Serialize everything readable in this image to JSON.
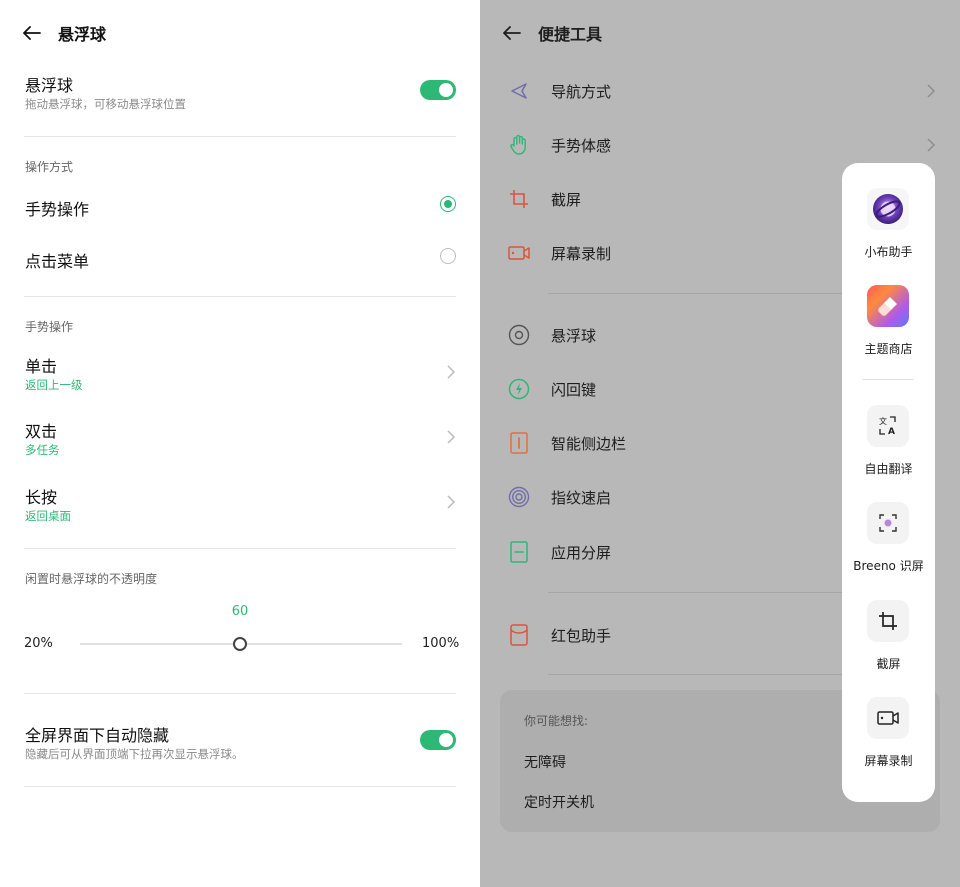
{
  "left": {
    "header": {
      "title": "悬浮球"
    },
    "float_ball": {
      "title": "悬浮球",
      "subtitle": "拖动悬浮球，可移动悬浮球位置",
      "enabled": true
    },
    "mode_section": {
      "label": "操作方式",
      "options": [
        {
          "label": "手势操作",
          "selected": true
        },
        {
          "label": "点击菜单",
          "selected": false
        }
      ]
    },
    "gesture_section": {
      "label": "手势操作",
      "items": [
        {
          "title": "单击",
          "value": "返回上一级"
        },
        {
          "title": "双击",
          "value": "多任务"
        },
        {
          "title": "长按",
          "value": "返回桌面"
        }
      ]
    },
    "opacity": {
      "label": "闲置时悬浮球的不透明度",
      "value": "60",
      "min": "20%",
      "max": "100%"
    },
    "fullscreen_hide": {
      "title": "全屏界面下自动隐藏",
      "subtitle": "隐藏后可从界面顶端下拉再次显示悬浮球。",
      "enabled": true
    }
  },
  "right": {
    "header": {
      "title": "便捷工具"
    },
    "items": [
      {
        "label": "导航方式",
        "icon": "navigation-arrow-icon",
        "color": "#6f6fa8"
      },
      {
        "label": "手势体感",
        "icon": "hand-icon",
        "color": "#2db876"
      },
      {
        "label": "截屏",
        "icon": "crop-icon",
        "color": "#d9563a"
      },
      {
        "label": "屏幕录制",
        "icon": "video-record-icon",
        "color": "#d9563a"
      },
      {
        "label": "悬浮球",
        "icon": "float-ball-icon",
        "color": "#555555"
      },
      {
        "label": "闪回键",
        "icon": "flash-back-icon",
        "color": "#2db876"
      },
      {
        "label": "智能侧边栏",
        "icon": "sidebar-icon",
        "color": "#e2703a"
      },
      {
        "label": "指纹速启",
        "icon": "fingerprint-icon",
        "color": "#6f6fa8"
      },
      {
        "label": "应用分屏",
        "icon": "split-screen-icon",
        "color": "#2db876"
      },
      {
        "label": "红包助手",
        "icon": "red-packet-icon",
        "color": "#d9563a"
      }
    ],
    "suggest": {
      "label": "你可能想找:",
      "items": [
        "无障碍",
        "定时开关机"
      ]
    },
    "toolbox": {
      "tools": [
        {
          "label": "小布助手",
          "icon": "breeno-assistant-icon"
        },
        {
          "label": "主题商店",
          "icon": "theme-store-icon"
        },
        {
          "label": "自由翻译",
          "icon": "translate-icon"
        },
        {
          "label": "Breeno 识屏",
          "icon": "screen-recognition-icon"
        },
        {
          "label": "截屏",
          "icon": "crop-icon"
        },
        {
          "label": "屏幕录制",
          "icon": "video-record-icon"
        }
      ]
    }
  },
  "colors": {
    "accent": "#2db876",
    "overlay": "#b8b8b8"
  }
}
